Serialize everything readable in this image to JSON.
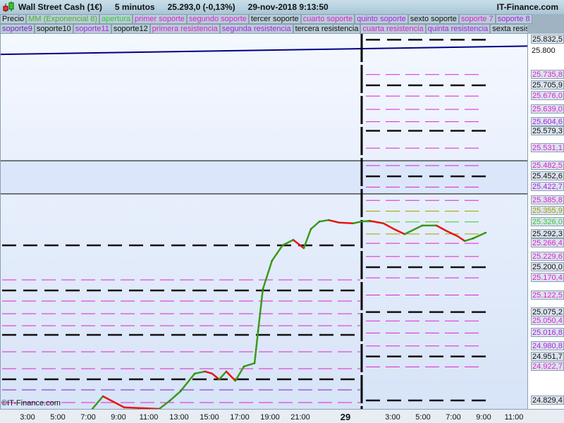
{
  "header": {
    "title": "Wall Street Cash (1€)",
    "timeframe": "5 minutos",
    "price": "25.293,0 (-0,13%)",
    "datetime": "29-nov-2018 9:13:50",
    "brand": "IT-Finance.com"
  },
  "legend_row1": [
    {
      "label": "Precio",
      "color": "#111111"
    },
    {
      "label": "MM (Exponencial 8)",
      "color": "#4caf2a"
    },
    {
      "label": "apertura",
      "color": "#33cc33"
    },
    {
      "label": "primer soporte",
      "color": "#e020d0"
    },
    {
      "label": "segundo soporte",
      "color": "#e020d0"
    },
    {
      "label": "tercer soporte",
      "color": "#111111"
    },
    {
      "label": "cuarto soporte",
      "color": "#e020d0"
    },
    {
      "label": "quinto soporte",
      "color": "#b020e0"
    },
    {
      "label": "sexto soporte",
      "color": "#111111"
    },
    {
      "label": "soporte 7",
      "color": "#e020d0"
    },
    {
      "label": "soporte 8",
      "color": "#b020e0"
    }
  ],
  "legend_row2": [
    {
      "label": "soporte9",
      "color": "#8020c0"
    },
    {
      "label": "soporte10",
      "color": "#111111"
    },
    {
      "label": "soporte11",
      "color": "#b020e0"
    },
    {
      "label": "soporte12",
      "color": "#111111"
    },
    {
      "label": "primera resistencia",
      "color": "#e020d0"
    },
    {
      "label": "segunda resistencia",
      "color": "#b020e0"
    },
    {
      "label": "tercera resistencia",
      "color": "#111111"
    },
    {
      "label": "cuarta resistencia",
      "color": "#e020d0"
    },
    {
      "label": "quinta resistencia",
      "color": "#b020e0"
    },
    {
      "label": "sexta resistencia",
      "color": "#111111"
    }
  ],
  "copyright": "©IT-Finance.com",
  "chart_data": {
    "type": "line",
    "ylim": [
      24780,
      25850
    ],
    "price_labels": [
      {
        "text": "25.832,5",
        "value": 25832.5,
        "color": "#111111",
        "style": "black"
      },
      {
        "text": "25.800",
        "value": 25800,
        "color": "#111111",
        "style": "plain"
      },
      {
        "text": "25.735,8",
        "value": 25735.8,
        "color": "#e020d0",
        "style": "magenta"
      },
      {
        "text": "25.705,9",
        "value": 25705.9,
        "color": "#111111",
        "style": "black"
      },
      {
        "text": "25.676,0",
        "value": 25676.0,
        "color": "#e020d0",
        "style": "magenta"
      },
      {
        "text": "25.639,0",
        "value": 25639.0,
        "color": "#e020d0",
        "style": "magenta"
      },
      {
        "text": "25.604,6",
        "value": 25604.6,
        "color": "#b020e0",
        "style": "magenta"
      },
      {
        "text": "25.579,3",
        "value": 25579.3,
        "color": "#111111",
        "style": "black"
      },
      {
        "text": "25.531,1",
        "value": 25531.1,
        "color": "#e020d0",
        "style": "magenta"
      },
      {
        "text": "25.482,5",
        "value": 25482.5,
        "color": "#e020d0",
        "style": "magenta"
      },
      {
        "text": "25.452,6",
        "value": 25452.6,
        "color": "#111111",
        "style": "black"
      },
      {
        "text": "25.422,7",
        "value": 25422.7,
        "color": "#b020e0",
        "style": "magenta"
      },
      {
        "text": "25.385,8",
        "value": 25385.8,
        "color": "#e020d0",
        "style": "magenta"
      },
      {
        "text": "25.355,9",
        "value": 25355.9,
        "color": "#a0a000",
        "style": "olive"
      },
      {
        "text": "25.326,0",
        "value": 25326.0,
        "color": "#33cc33",
        "style": "green"
      },
      {
        "text": "25.292,3",
        "value": 25292.3,
        "color": "#111111",
        "style": "olive"
      },
      {
        "text": "25.266,4",
        "value": 25266.4,
        "color": "#e020d0",
        "style": "magenta"
      },
      {
        "text": "25.229,6",
        "value": 25229.6,
        "color": "#e020d0",
        "style": "magenta"
      },
      {
        "text": "25.200,0",
        "value": 25200.0,
        "color": "#111111",
        "style": "black"
      },
      {
        "text": "25.170,4",
        "value": 25170.4,
        "color": "#e020d0",
        "style": "magenta"
      },
      {
        "text": "25.122,5",
        "value": 25122.5,
        "color": "#e020d0",
        "style": "magenta"
      },
      {
        "text": "25.075,2",
        "value": 25075.2,
        "color": "#111111",
        "style": "black"
      },
      {
        "text": "25.050,4",
        "value": 25050.4,
        "color": "#e020d0",
        "style": "magenta"
      },
      {
        "text": "25.016,8",
        "value": 25016.8,
        "color": "#b020e0",
        "style": "magenta"
      },
      {
        "text": "24.980,8",
        "value": 24980.8,
        "color": "#b020e0",
        "style": "magenta"
      },
      {
        "text": "24.951,7",
        "value": 24951.7,
        "color": "#111111",
        "style": "black"
      },
      {
        "text": "24.922,7",
        "value": 24922.7,
        "color": "#e020d0",
        "style": "magenta"
      },
      {
        "text": "24.829,4",
        "value": 24829.4,
        "color": "#111111",
        "style": "black"
      }
    ],
    "previous_day_levels": [
      {
        "value": 25260.8,
        "style": "black"
      },
      {
        "value": 25164.7,
        "style": "magenta"
      },
      {
        "value": 25135.3,
        "style": "black"
      },
      {
        "value": 25105.9,
        "style": "magenta"
      },
      {
        "value": 25070.6,
        "style": "magenta"
      },
      {
        "value": 25037.3,
        "style": "magenta"
      },
      {
        "value": 25011.8,
        "style": "black"
      },
      {
        "value": 24964.7,
        "style": "magenta"
      },
      {
        "value": 24917.6,
        "style": "magenta"
      },
      {
        "value": 24888.2,
        "style": "black"
      },
      {
        "value": 24858.8,
        "style": "purple"
      },
      {
        "value": 24823.5,
        "style": "magenta"
      }
    ],
    "band": [
      25404,
      25496
    ],
    "trendline": {
      "from": 25792,
      "to": 25815,
      "color": "#000080"
    },
    "x_ticks": [
      "3:00",
      "5:00",
      "7:00",
      "9:00",
      "11:00",
      "13:00",
      "15:00",
      "17:00",
      "19:00",
      "21:00",
      "29",
      "3:00",
      "5:00",
      "7:00",
      "9:00",
      "11:00"
    ],
    "series": [
      {
        "name": "MM (Exponencial 8)",
        "points": [
          [
            "28 7:14",
            24806
          ],
          [
            "28 7:56",
            24841
          ],
          [
            "28 9:20",
            24810
          ],
          [
            "28 11:39",
            24806
          ],
          [
            "28 12:21",
            24829
          ],
          [
            "28 13:03",
            24855
          ],
          [
            "28 13:59",
            24904
          ],
          [
            "28 14:40",
            24910
          ],
          [
            "28 15:08",
            24904
          ],
          [
            "28 15:36",
            24888
          ],
          [
            "28 16:04",
            24910
          ],
          [
            "28 16:40",
            24884
          ],
          [
            "28 17:14",
            24924
          ],
          [
            "28 17:56",
            24933
          ],
          [
            "28 18:10",
            25022
          ],
          [
            "28 18:29",
            25139
          ],
          [
            "28 19:05",
            25218
          ],
          [
            "28 19:47",
            25261
          ],
          [
            "28 20:29",
            25276
          ],
          [
            "28 21:11",
            25253
          ],
          [
            "28 21:39",
            25306
          ],
          [
            "28 22:13",
            25327
          ],
          [
            "28 22:49",
            25331
          ],
          [
            "28 23:31",
            25324
          ],
          [
            "29 0:26",
            25322
          ],
          [
            "29 1:00",
            25327
          ],
          [
            "29 1:31",
            25329
          ],
          [
            "29 2:26",
            25322
          ],
          [
            "29 3:08",
            25306
          ],
          [
            "29 3:50",
            25292
          ],
          [
            "29 5:00",
            25316
          ],
          [
            "29 5:56",
            25316
          ],
          [
            "29 6:38",
            25300
          ],
          [
            "29 7:20",
            25286
          ],
          [
            "29 7:48",
            25273
          ],
          [
            "29 8:21",
            25280
          ],
          [
            "29 9:11",
            25296
          ]
        ]
      }
    ]
  }
}
